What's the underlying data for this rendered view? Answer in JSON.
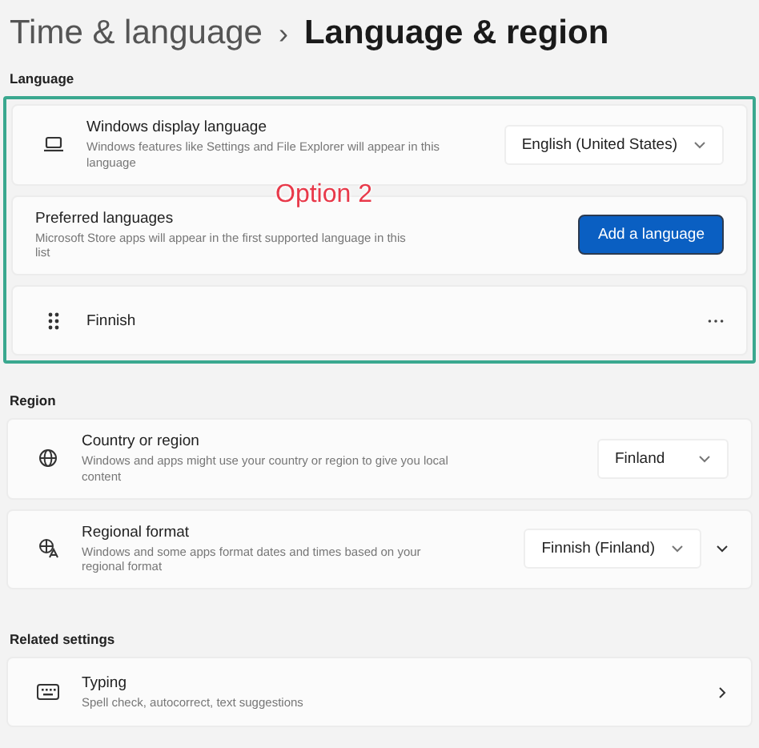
{
  "breadcrumb": {
    "parent": "Time & language",
    "separator": "›",
    "current": "Language & region"
  },
  "sections": [
    {
      "title": "Language",
      "highlighted": true,
      "rows": [
        {
          "kind": "dropdown",
          "title": "Windows display language",
          "description": "Windows features like Settings and File Explorer will appear in this language",
          "value": "English (United States)"
        },
        {
          "kind": "button",
          "title": "Preferred languages",
          "description": "Microsoft Store apps will appear in the first supported language in this list",
          "button": "Add a language"
        },
        {
          "kind": "list_item",
          "title": "Finnish"
        }
      ]
    },
    {
      "title": "Region",
      "highlighted": false,
      "rows": [
        {
          "kind": "dropdown",
          "title": "Country or region",
          "description": "Windows and apps might use your country or region to give you local content",
          "value": "Finland"
        },
        {
          "kind": "dropdown",
          "title": "Regional format",
          "description": "Windows and some apps format dates and times based on your regional format",
          "value": "Finnish (Finland)",
          "expanded": false
        }
      ]
    },
    {
      "title": "Related settings",
      "highlighted": false,
      "rows": [
        {
          "kind": "link",
          "title": "Typing",
          "description": "Spell check, autocorrect, text suggestions"
        }
      ]
    }
  ],
  "annotation": {
    "text": "Option 2"
  }
}
